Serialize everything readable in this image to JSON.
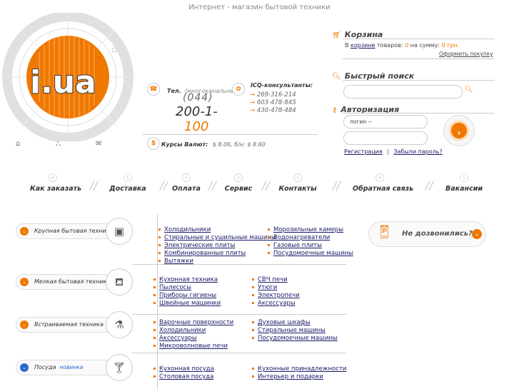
{
  "header": {
    "site_title": "Интернет - магазин бытовой техники"
  },
  "logo": {
    "text": "i.ua",
    "colors": {
      "orange": "#f07800",
      "white": "#ffffff"
    }
  },
  "util_icons": [
    "home-icon",
    "sitemap-icon",
    "mail-icon"
  ],
  "contacts": {
    "phone_label": "Тел.",
    "phone_label_note": "(многоканальный)",
    "phone_code": "(044)",
    "phone_number_part1": "200-1-",
    "phone_number_part2": "100",
    "icq_label": "ICQ-консультанты:",
    "icq_numbers": [
      "269-316-214",
      "603-478-845",
      "430-478-484"
    ],
    "currency_label": "Курсы Валют:",
    "currency_values": "$ 8.06, б/н: $ 8.60"
  },
  "cart": {
    "title": "Корзина",
    "text_prefix": "В",
    "link": "корзине",
    "text_items": "товаров:",
    "items_count": "0",
    "text_sum": "на сумму:",
    "sum": "0 грн.",
    "checkout": "Оформить покупку"
  },
  "search": {
    "title": "Быстрый поиск",
    "placeholder": ""
  },
  "auth": {
    "title": "Авторизация",
    "login_value": "логин --",
    "password_value": "",
    "register": "Регистрация",
    "separator": "|",
    "forgot": "Забыли пароль?"
  },
  "nav": [
    {
      "label": "Как заказать"
    },
    {
      "label": "Доставка"
    },
    {
      "label": "Оплата"
    },
    {
      "label": "Сервис"
    },
    {
      "label": "Контакты"
    },
    {
      "label": "Обратная связь"
    },
    {
      "label": "Вакансии"
    }
  ],
  "categories": [
    {
      "name": "Крупная бытовая техника",
      "icon": "washing-machine-icon",
      "col1": [
        "Холодильники",
        "Стиральные и сушильные машины",
        "Электрические плиты",
        "Комбинированные плиты",
        "Вытяжки"
      ],
      "col2": [
        "Морозильные камеры",
        "Водонагреватели",
        "Газовые плиты",
        "Посудомоечные машины"
      ]
    },
    {
      "name": "Мелкая бытовая техника",
      "icon": "kettle-icon",
      "col1": [
        "Кухонная техника",
        "Пылесосы",
        "Приборы гигиены",
        "Швейные машинки"
      ],
      "col2": [
        "СВЧ печи",
        "Утюги",
        "Электропечи",
        "Аксессуары"
      ]
    },
    {
      "name": "Встраиваемая техника",
      "icon": "flask-icon",
      "col1": [
        "Варочные поверхности",
        "Холодильники",
        "Аксессуары",
        "Микроволновые печи"
      ],
      "col2": [
        "Духовые шкафы",
        "Стиральные машины",
        "Посудомоечные машины"
      ]
    },
    {
      "name": "Посуда",
      "badge": "новинка",
      "icon": "glass-icon",
      "col1": [
        "Кухонная посуда",
        "Столовая посуда"
      ],
      "col2": [
        "Кухонные принадлежности",
        "Интерьер и подарки"
      ]
    }
  ],
  "callback": {
    "label": "Не дозвонились?"
  }
}
